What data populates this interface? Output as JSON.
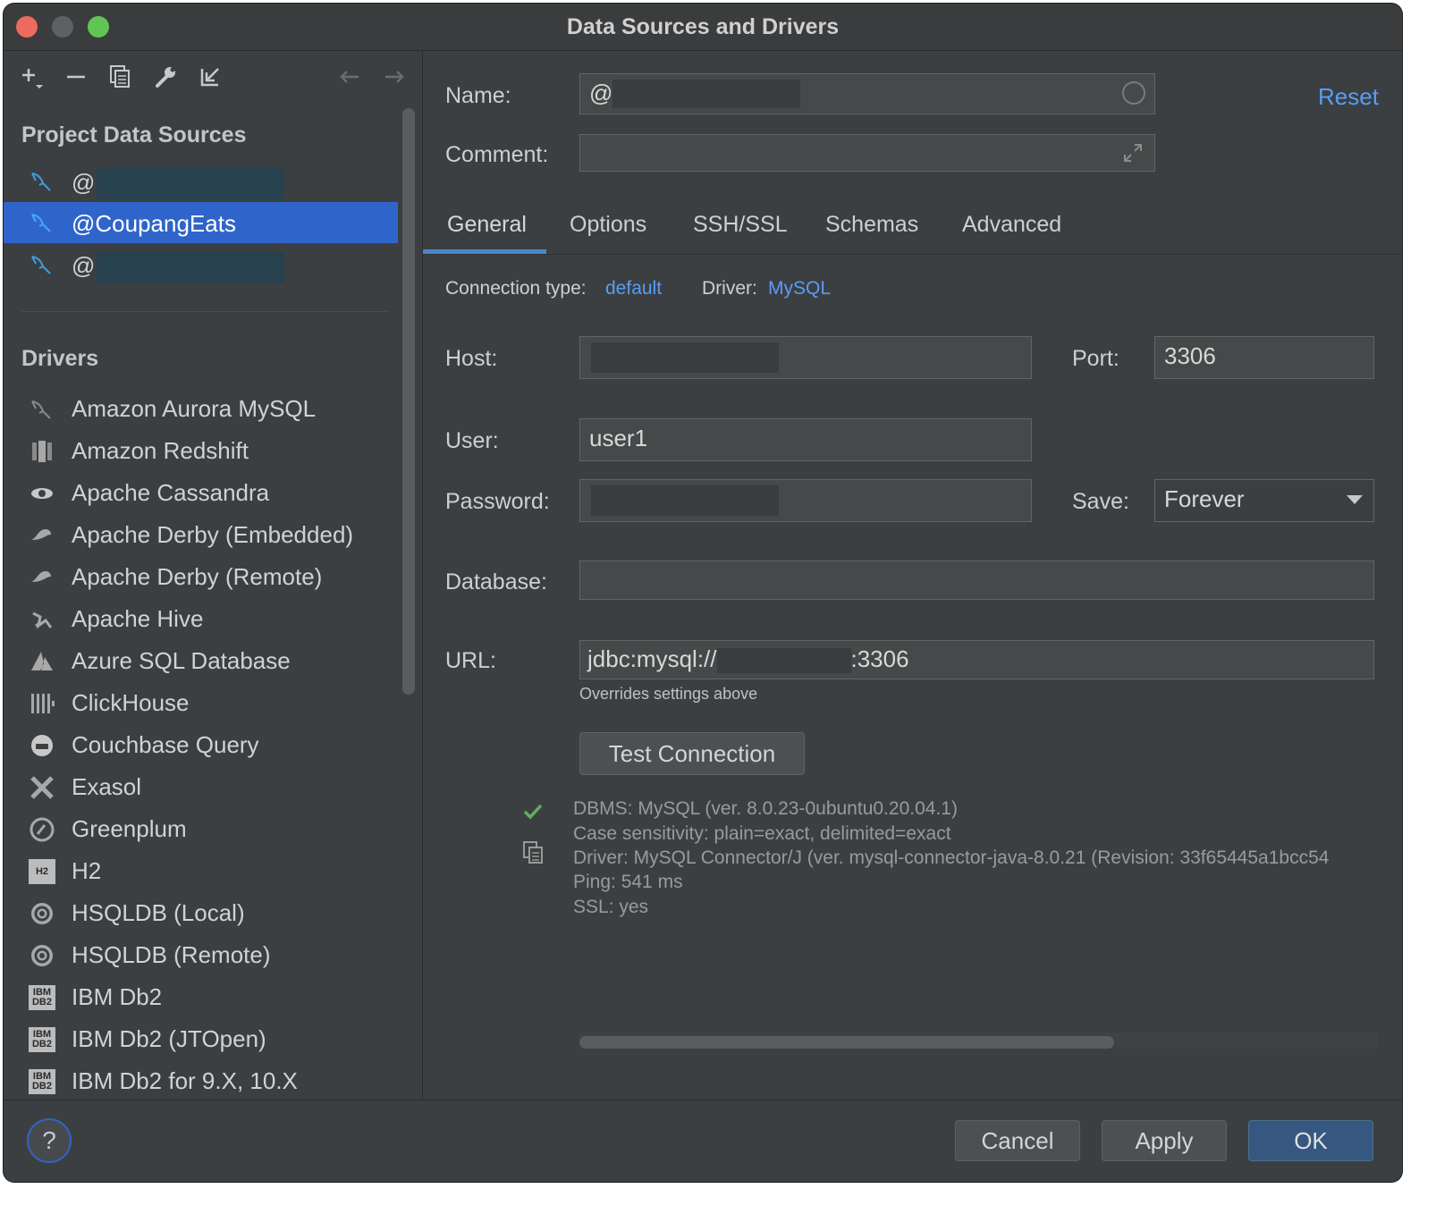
{
  "window": {
    "title": "Data Sources and Drivers"
  },
  "sidebar": {
    "project_heading": "Project Data Sources",
    "data_sources": [
      {
        "label": "@",
        "redacted": true,
        "selected": false
      },
      {
        "label": "@CoupangEats",
        "redacted": false,
        "selected": true
      },
      {
        "label": "@",
        "redacted": true,
        "selected": false
      }
    ],
    "drivers_heading": "Drivers",
    "drivers": [
      {
        "label": "Amazon Aurora MySQL",
        "icon": "dolphin-icon"
      },
      {
        "label": "Amazon Redshift",
        "icon": "redshift-icon"
      },
      {
        "label": "Apache Cassandra",
        "icon": "eye-icon"
      },
      {
        "label": "Apache Derby (Embedded)",
        "icon": "derby-hat-icon"
      },
      {
        "label": "Apache Derby (Remote)",
        "icon": "derby-hat-icon"
      },
      {
        "label": "Apache Hive",
        "icon": "hive-icon"
      },
      {
        "label": "Azure SQL Database",
        "icon": "azure-icon"
      },
      {
        "label": "ClickHouse",
        "icon": "clickhouse-icon"
      },
      {
        "label": "Couchbase Query",
        "icon": "couchbase-icon"
      },
      {
        "label": "Exasol",
        "icon": "exasol-icon"
      },
      {
        "label": "Greenplum",
        "icon": "greenplum-icon"
      },
      {
        "label": "H2",
        "icon": "h2-icon",
        "glyph": "H2"
      },
      {
        "label": "HSQLDB (Local)",
        "icon": "hsqldb-icon"
      },
      {
        "label": "HSQLDB (Remote)",
        "icon": "hsqldb-icon"
      },
      {
        "label": "IBM Db2",
        "icon": "ibm-db2-icon",
        "glyph": "IBM DB2"
      },
      {
        "label": "IBM Db2 (JTOpen)",
        "icon": "ibm-db2-icon",
        "glyph": "IBM DB2"
      },
      {
        "label": "IBM Db2 for 9.X, 10.X",
        "icon": "ibm-db2-icon",
        "glyph": "IBM DB2"
      }
    ]
  },
  "form": {
    "name_label": "Name:",
    "name_value": "@",
    "reset_label": "Reset",
    "comment_label": "Comment:",
    "tabs": [
      "General",
      "Options",
      "SSH/SSL",
      "Schemas",
      "Advanced"
    ],
    "active_tab": "General",
    "connection_type_label": "Connection type:",
    "connection_type_value": "default",
    "driver_label": "Driver:",
    "driver_value": "MySQL",
    "host_label": "Host:",
    "port_label": "Port:",
    "port_value": "3306",
    "user_label": "User:",
    "user_value": "user1",
    "password_label": "Password:",
    "save_label": "Save:",
    "save_value": "Forever",
    "database_label": "Database:",
    "url_label": "URL:",
    "url_prefix": "jdbc:mysql://",
    "url_suffix": ":3306",
    "url_hint": "Overrides settings above",
    "test_connection_label": "Test Connection",
    "result_lines": [
      "DBMS: MySQL (ver. 8.0.23-0ubuntu0.20.04.1)",
      "Case sensitivity: plain=exact, delimited=exact",
      "Driver: MySQL Connector/J (ver. mysql-connector-java-8.0.21 (Revision: 33f65445a1bcc54",
      "Ping: 541 ms",
      "SSL: yes"
    ]
  },
  "footer": {
    "help_label": "?",
    "cancel_label": "Cancel",
    "apply_label": "Apply",
    "ok_label": "OK"
  },
  "colors": {
    "accent": "#2f65ca",
    "link": "#589df6",
    "success": "#5fb05f",
    "background": "#3c3f41"
  }
}
